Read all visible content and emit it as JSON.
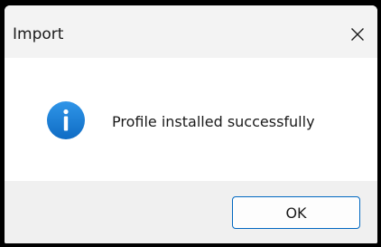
{
  "window": {
    "title": "Import",
    "close_icon": "close-icon"
  },
  "body": {
    "icon": "info-icon",
    "message": "Profile installed successfully"
  },
  "footer": {
    "ok_label": "OK"
  },
  "colors": {
    "accent": "#0067c0",
    "info_icon": "#1a7fd4",
    "titlebar_bg": "#f3f3f3",
    "footer_bg": "#f0f0f0"
  }
}
